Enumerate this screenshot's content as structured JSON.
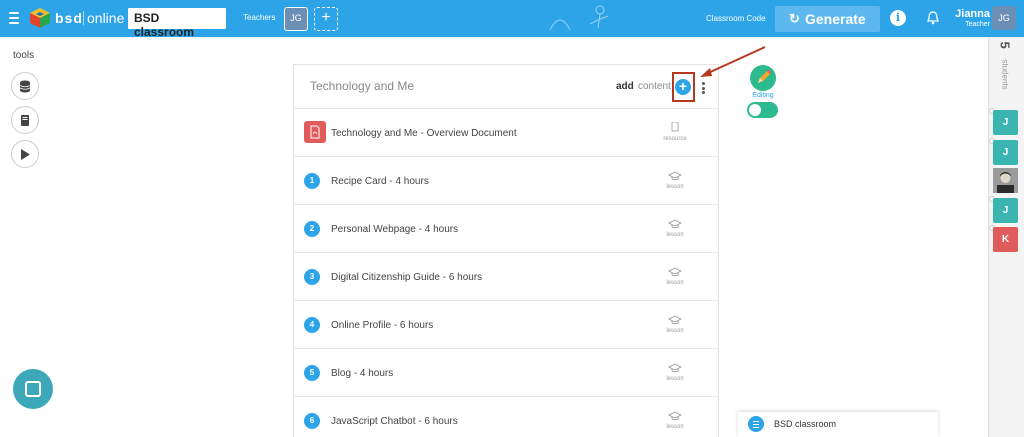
{
  "header": {
    "brand_primary": "bsd",
    "brand_secondary": "online",
    "class_name": "BSD classroom",
    "teachers_label": "Teachers",
    "teacher_initials": "JG",
    "add_teacher": "+",
    "classroom_code_label": "Classroom Code",
    "generate_label": "Generate",
    "info_label": "i",
    "user_name": "Jianna",
    "user_role": "Teacher",
    "user_initials": "JG",
    "accent_color": "#2da4e8"
  },
  "tools": {
    "label": "tools",
    "items": [
      "database-icon",
      "book-icon",
      "play-icon"
    ]
  },
  "unit": {
    "title": "Technology and Me",
    "add_label": "add",
    "content_label": "content",
    "plus": "+",
    "items": [
      {
        "marker": "pdf",
        "title": "Technology and Me - Overview Document",
        "type": "resource"
      },
      {
        "marker": "1",
        "title": "Recipe Card - 4 hours",
        "type": "lesson"
      },
      {
        "marker": "2",
        "title": "Personal Webpage - 4 hours",
        "type": "lesson"
      },
      {
        "marker": "3",
        "title": "Digital Citizenship Guide - 6 hours",
        "type": "lesson"
      },
      {
        "marker": "4",
        "title": "Online Profile - 6 hours",
        "type": "lesson"
      },
      {
        "marker": "5",
        "title": "Blog - 4 hours",
        "type": "lesson"
      },
      {
        "marker": "6",
        "title": "JavaScript Chatbot - 6 hours",
        "type": "lesson"
      }
    ]
  },
  "editing": {
    "label": "Editing",
    "enabled": true,
    "color": "#2dba8e"
  },
  "students": {
    "count": "5",
    "label": "students",
    "list": [
      {
        "initial": "J",
        "color": "#3bb5b0"
      },
      {
        "initial": "J",
        "color": "#3bb5b0"
      },
      {
        "initial": "",
        "color": "#888888"
      },
      {
        "initial": "J",
        "color": "#3bb5b0"
      },
      {
        "initial": "K",
        "color": "#e05b5b"
      }
    ]
  },
  "tray": {
    "label": "BSD classroom"
  }
}
